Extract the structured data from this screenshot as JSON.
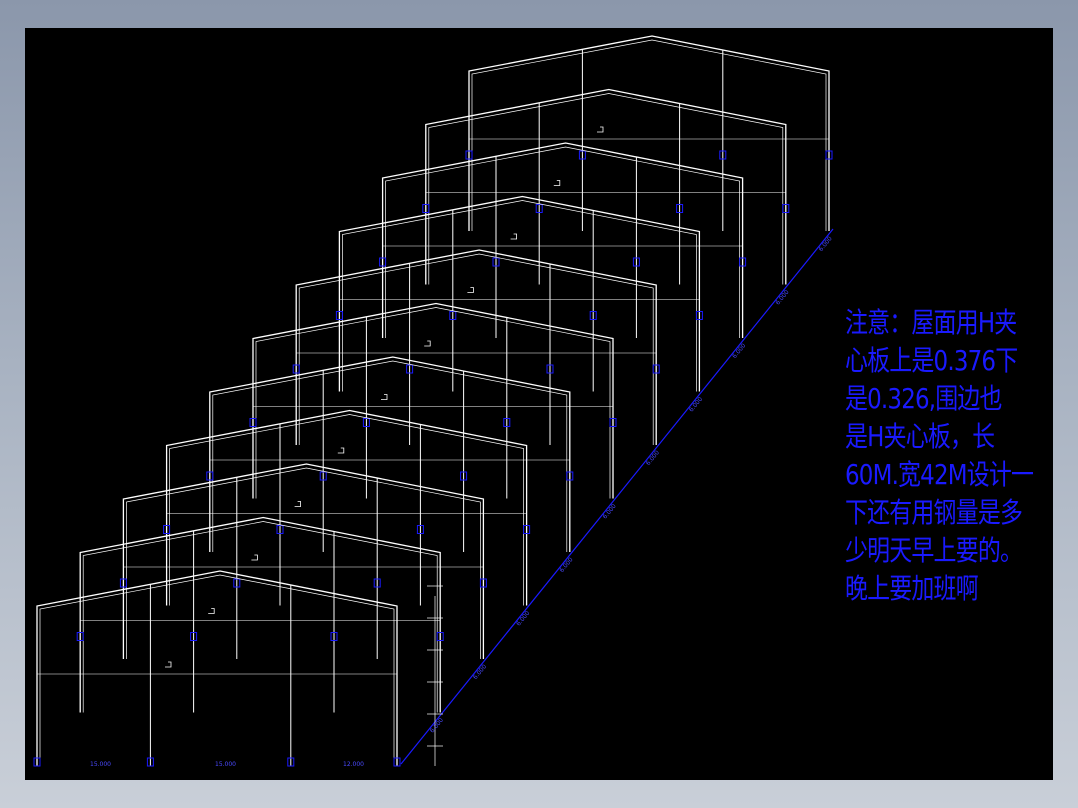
{
  "note": {
    "lines": [
      "注意：屋面用H夹",
      "心板上是0.376下",
      "是0.326,围边也",
      "是H夹心板，长",
      "60M.宽42M设计一",
      "下还有用钢量是多",
      "少明天早上要的。",
      "晚上要加班啊"
    ]
  },
  "drawing": {
    "frame_count": 11,
    "bay_labels": [
      "6.000",
      "6.000",
      "6.000",
      "6.000",
      "6.000",
      "6.000",
      "6.000",
      "6.000",
      "6.000",
      "6.000"
    ],
    "span_labels": [
      "15.000",
      "15.000",
      "12.000"
    ]
  },
  "colors": {
    "background": "#000000",
    "lines": "#ffffff",
    "annotations": "#1a1aff"
  }
}
